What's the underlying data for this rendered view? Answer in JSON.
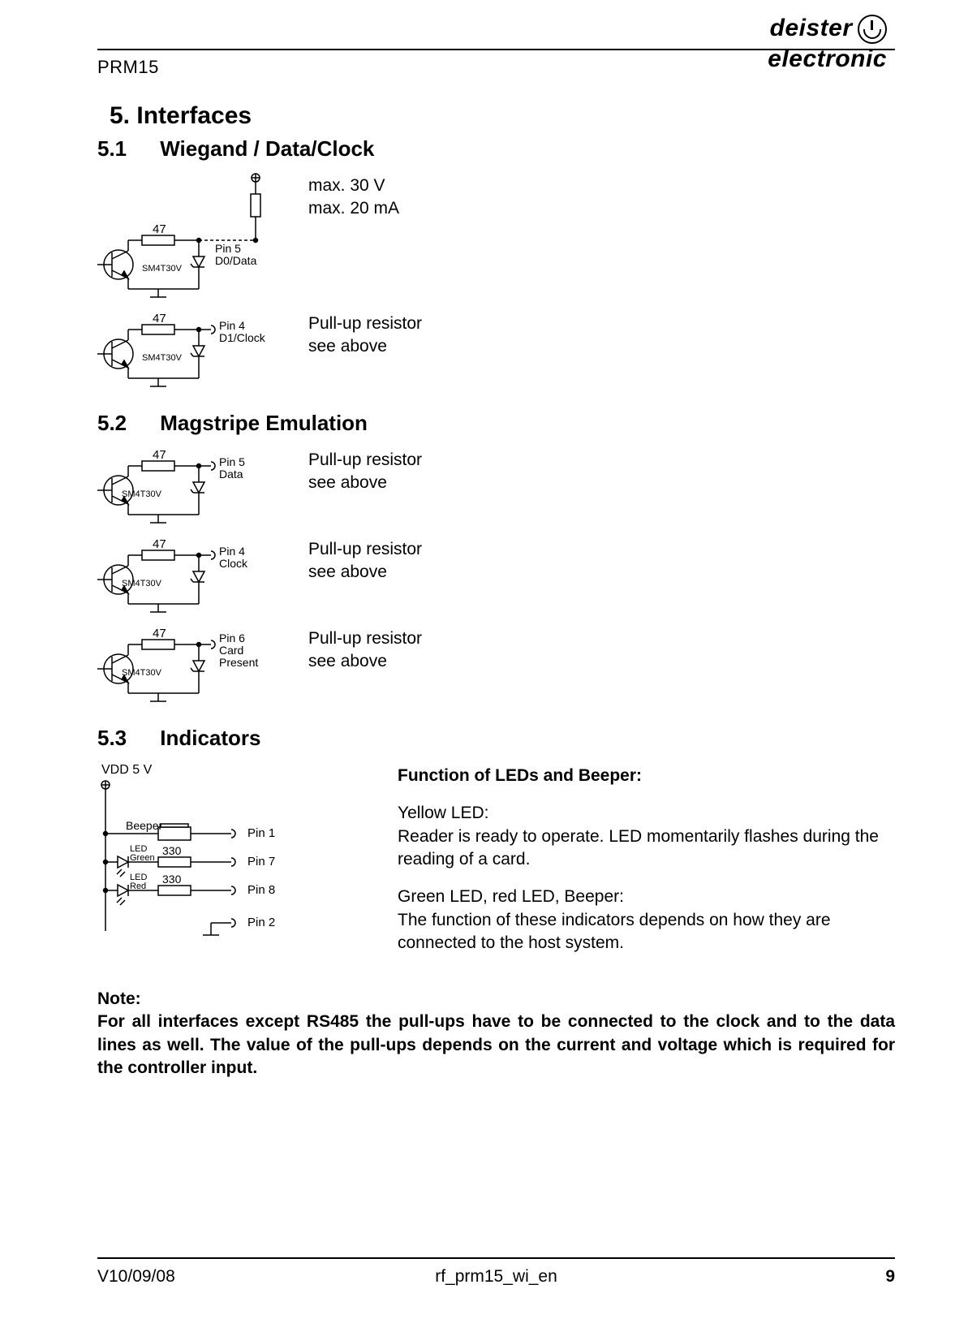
{
  "header": {
    "doc_code": "PRM15",
    "logo_line1": "deister",
    "logo_line2": "electronic"
  },
  "section": {
    "number": "5.",
    "title": "Interfaces"
  },
  "s51": {
    "number": "5.1",
    "title": "Wiegand / Data/Clock",
    "spec1": "max. 30 V",
    "spec2": "max. 20 mA",
    "circuit1": {
      "r_label": "47",
      "pin_label": "Pin 5",
      "signal": "D0/Data",
      "tvs": "SM4T30V"
    },
    "circuit2": {
      "r_label": "47",
      "pin_label": "Pin 4",
      "signal": "D1/Clock",
      "tvs": "SM4T30V",
      "note1": "Pull-up resistor",
      "note2": "see above"
    }
  },
  "s52": {
    "number": "5.2",
    "title": "Magstripe Emulation",
    "circuits": [
      {
        "r_label": "47",
        "pin_label": "Pin 5",
        "signal": "Data",
        "tvs": "SM4T30V",
        "note1": "Pull-up resistor",
        "note2": "see above"
      },
      {
        "r_label": "47",
        "pin_label": "Pin 4",
        "signal": "Clock",
        "tvs": "SM4T30V",
        "note1": "Pull-up resistor",
        "note2": "see above"
      },
      {
        "r_label": "47",
        "pin_label": "Pin 6",
        "signal": "Card",
        "signal2": "Present",
        "tvs": "SM4T30V",
        "note1": "Pull-up resistor",
        "note2": "see above"
      }
    ]
  },
  "s53": {
    "number": "5.3",
    "title": "Indicators",
    "diagram": {
      "vdd": "VDD  5 V",
      "beeper": "Beeper",
      "led_green": "LED",
      "led_green2": "Green",
      "led_red": "LED",
      "led_red2": "Red",
      "r_green": "330",
      "r_red": "330",
      "pin1": "Pin 1",
      "pin7": "Pin 7",
      "pin8": "Pin 8",
      "pin2": "Pin 2"
    },
    "text": {
      "heading": "Function of LEDs and Beeper:",
      "yellow_h": "Yellow LED:",
      "yellow_b": "Reader is ready to operate. LED momentarily flashes during the reading of a card.",
      "grb_h": "Green LED, red LED, Beeper:",
      "grb_b": "The function of these indicators depends on how they are connected to the host system."
    }
  },
  "note": {
    "label": "Note:",
    "body": "For all interfaces except RS485 the pull-ups have to be connected to the clock and to the data lines as well. The value of the pull-ups depends on the current and voltage which is required for the controller input."
  },
  "footer": {
    "left": "V10/09/08",
    "center": "rf_prm15_wi_en",
    "right": "9"
  }
}
